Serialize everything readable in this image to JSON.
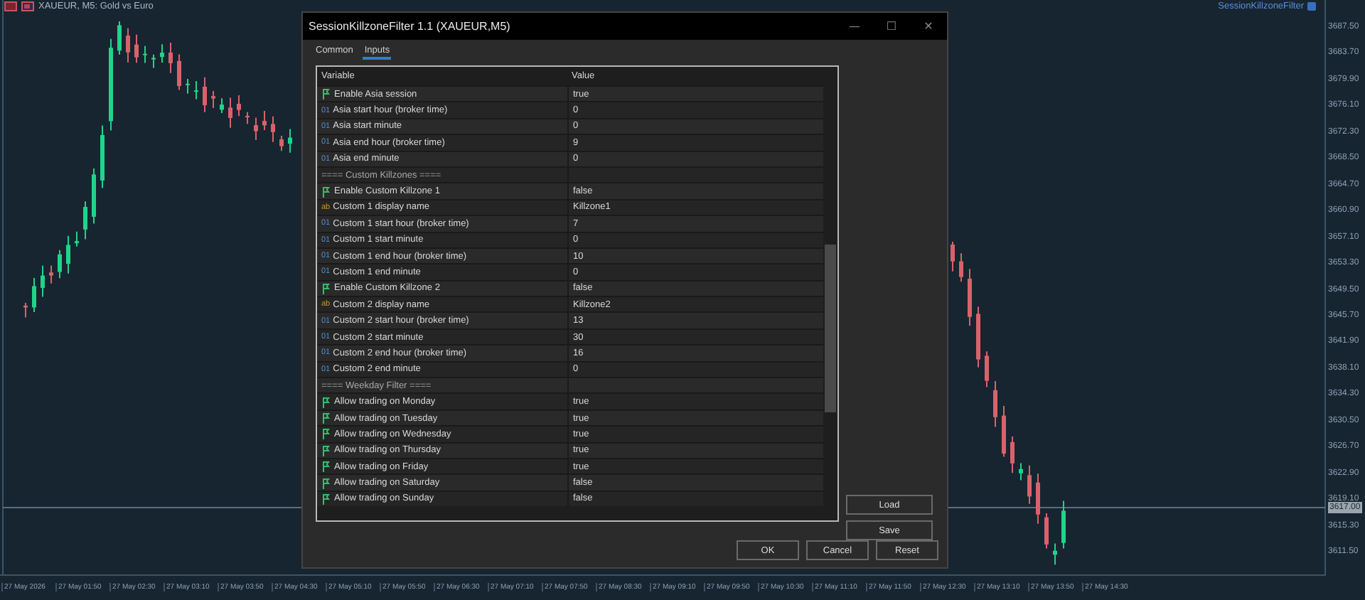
{
  "chart": {
    "symbol_label": "XAUEUR, M5:  Gold vs Euro",
    "indicator_label": "SessionKillzoneFilter",
    "prices": [
      "3687.50",
      "3683.70",
      "3679.90",
      "3676.10",
      "3672.30",
      "3668.50",
      "3664.70",
      "3660.90",
      "3657.10",
      "3653.30",
      "3649.50",
      "3645.70",
      "3641.90",
      "3638.10",
      "3634.30",
      "3630.50",
      "3626.70",
      "3622.90",
      "3619.10",
      "3615.30",
      "3611.50"
    ],
    "current_price": "3617.00",
    "times": [
      "27 May 2026",
      "27 May 01:50",
      "27 May 02:30",
      "27 May 03:10",
      "27 May 03:50",
      "27 May 04:30",
      "27 May 05:10",
      "27 May 05:50",
      "27 May 06:30",
      "27 May 07:10",
      "27 May 07:50",
      "27 May 08:30",
      "27 May 09:10",
      "27 May 09:50",
      "27 May 10:30",
      "27 May 11:10",
      "27 May 11:50",
      "27 May 12:30",
      "27 May 13:10",
      "27 May 13:50",
      "27 May 14:30"
    ]
  },
  "window": {
    "title": "SessionKillzoneFilter 1.1 (XAUEUR,M5)",
    "controls": [
      "—",
      "☐",
      "✕"
    ]
  },
  "tabs": [
    {
      "label": "Common",
      "selected": false
    },
    {
      "label": "Inputs",
      "selected": true
    }
  ],
  "table": {
    "columns": [
      "Variable",
      "Value"
    ],
    "rows": [
      {
        "kind": "bool",
        "name": "Enable Asia session",
        "value": "true"
      },
      {
        "kind": "int",
        "type_label": "01",
        "name": "Asia start hour (broker time)",
        "value": "0"
      },
      {
        "kind": "int",
        "type_label": "01",
        "name": "Asia start minute",
        "value": "0"
      },
      {
        "kind": "int",
        "type_label": "01",
        "name": "Asia end hour (broker time)",
        "value": "9"
      },
      {
        "kind": "int",
        "type_label": "01",
        "name": "Asia end minute",
        "value": "0"
      },
      {
        "kind": "section",
        "name": "==== Custom Killzones ===="
      },
      {
        "kind": "bool",
        "name": "Enable Custom Killzone 1",
        "value": "false"
      },
      {
        "kind": "string",
        "type_label": "ab",
        "name": "Custom 1 display name",
        "value": "Killzone1"
      },
      {
        "kind": "int",
        "type_label": "01",
        "name": "Custom 1 start hour (broker time)",
        "value": "7"
      },
      {
        "kind": "int",
        "type_label": "01",
        "name": "Custom 1 start minute",
        "value": "0"
      },
      {
        "kind": "int",
        "type_label": "01",
        "name": "Custom 1 end hour (broker time)",
        "value": "10"
      },
      {
        "kind": "int",
        "type_label": "01",
        "name": "Custom 1 end minute",
        "value": "0"
      },
      {
        "kind": "bool",
        "name": "Enable Custom Killzone 2",
        "value": "false"
      },
      {
        "kind": "string",
        "type_label": "ab",
        "name": "Custom 2 display name",
        "value": "Killzone2"
      },
      {
        "kind": "int",
        "type_label": "01",
        "name": "Custom 2 start hour (broker time)",
        "value": "13"
      },
      {
        "kind": "int",
        "type_label": "01",
        "name": "Custom 2 start minute",
        "value": "30"
      },
      {
        "kind": "int",
        "type_label": "01",
        "name": "Custom 2 end hour (broker time)",
        "value": "16"
      },
      {
        "kind": "int",
        "type_label": "01",
        "name": "Custom 2 end minute",
        "value": "0"
      },
      {
        "kind": "section",
        "name": "==== Weekday Filter ===="
      },
      {
        "kind": "bool",
        "name": "Allow trading on Monday",
        "value": "true"
      },
      {
        "kind": "bool",
        "name": "Allow trading on Tuesday",
        "value": "true"
      },
      {
        "kind": "bool",
        "name": "Allow trading on Wednesday",
        "value": "true"
      },
      {
        "kind": "bool",
        "name": "Allow trading on Thursday",
        "value": "true"
      },
      {
        "kind": "bool",
        "name": "Allow trading on Friday",
        "value": "true"
      },
      {
        "kind": "bool",
        "name": "Allow trading on Saturday",
        "value": "false"
      },
      {
        "kind": "bool",
        "name": "Allow trading on Sunday",
        "value": "false"
      }
    ]
  },
  "side_buttons": [
    "Load",
    "Save"
  ],
  "buttons": [
    "OK",
    "Cancel",
    "Reset"
  ]
}
